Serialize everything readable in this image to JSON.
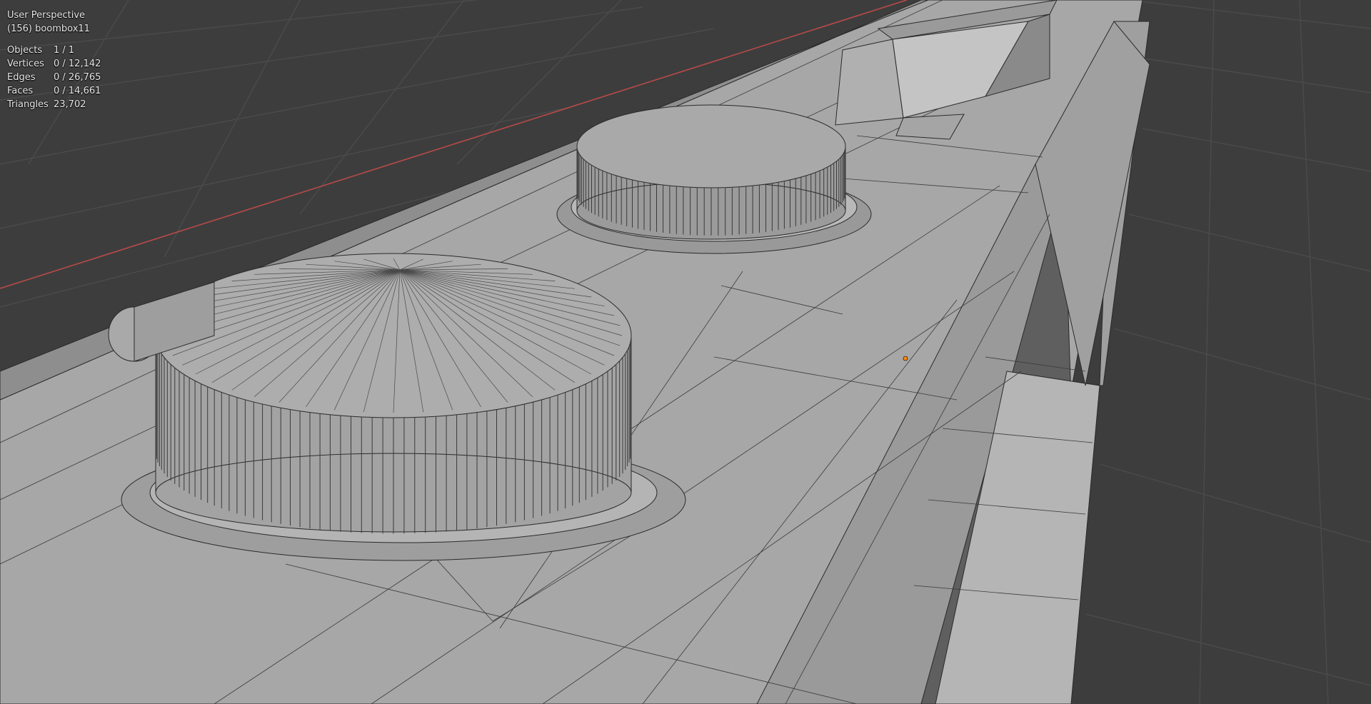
{
  "viewport": {
    "view_name": "User Perspective",
    "object_info": "(156) boombox11",
    "stats": [
      {
        "label": "Objects",
        "value": "1 / 1"
      },
      {
        "label": "Vertices",
        "value": "0 / 12,142"
      },
      {
        "label": "Edges",
        "value": "0 / 26,765"
      },
      {
        "label": "Faces",
        "value": "0 / 14,661"
      },
      {
        "label": "Triangles",
        "value": "23,702"
      }
    ]
  },
  "colors": {
    "background": "#3d3d3d",
    "grid_line": "#4a4a4a",
    "x_axis": "#b84a4a",
    "mesh_face": "#a8a8a8",
    "mesh_edge": "#2a2a2a",
    "origin_dot": "#ff8a00"
  }
}
